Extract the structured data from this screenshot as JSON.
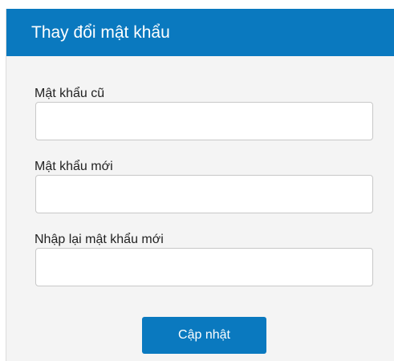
{
  "form": {
    "title": "Thay đổi mật khẩu",
    "old_password": {
      "label": "Mật khẩu cũ",
      "value": "",
      "placeholder": ""
    },
    "new_password": {
      "label": "Mật khẩu mới",
      "value": "",
      "placeholder": ""
    },
    "confirm_password": {
      "label": "Nhập lại mật khẩu mới",
      "value": "",
      "placeholder": ""
    },
    "submit_label": "Cập nhật"
  },
  "colors": {
    "accent": "#0a79bf",
    "body_background": "#f4f4f4",
    "input_border": "#c8c8c8"
  }
}
